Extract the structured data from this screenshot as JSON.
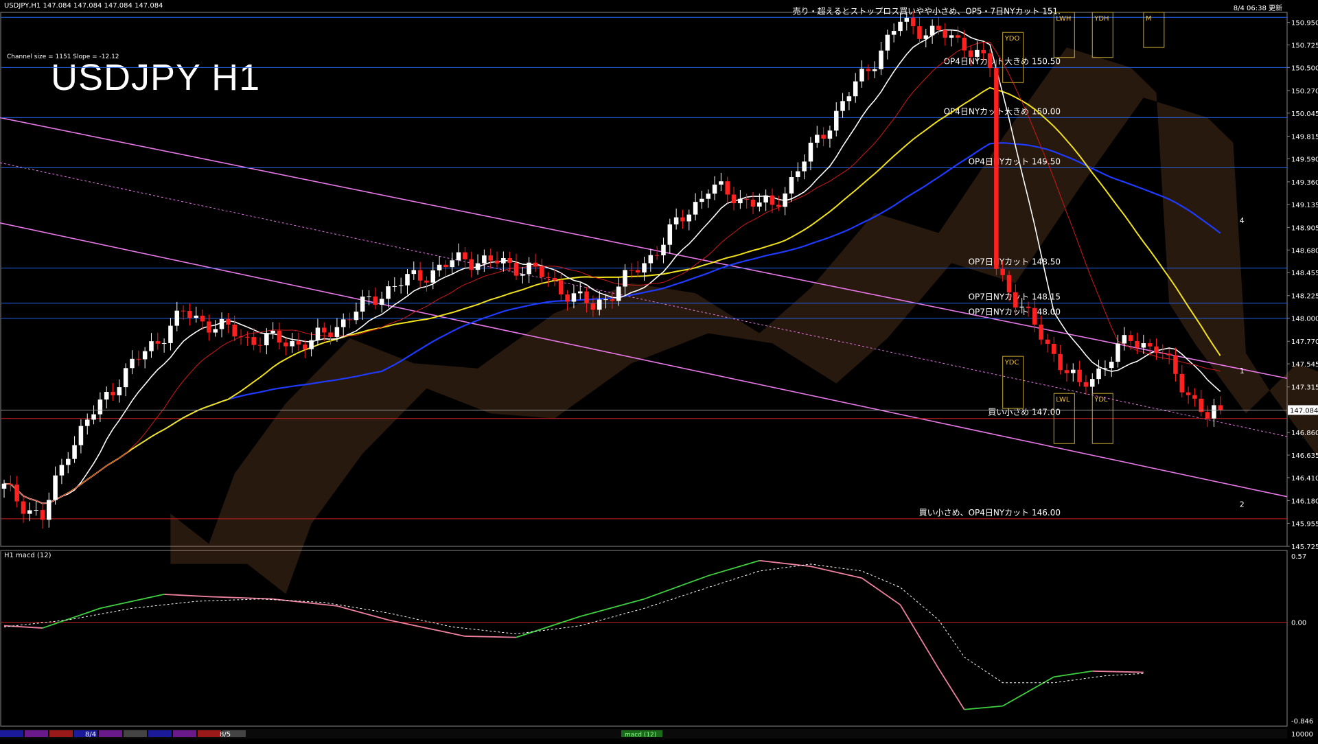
{
  "header": {
    "symbol_line": "USDJPY,H1  147.084 147.084 147.084 147.084",
    "timestamp": "8/4 06:38 更新",
    "channel_info": "Channel size = 1151 Slope = -12.12",
    "chart_title": "USDJPY H1"
  },
  "chart_data": [
    {
      "type": "candlestick",
      "title": "USDJPY H1",
      "y_ticks": [
        "150.950",
        "150.725",
        "150.500",
        "150.270",
        "150.045",
        "149.815",
        "149.590",
        "149.360",
        "149.135",
        "148.905",
        "148.680",
        "148.455",
        "148.225",
        "148.000",
        "147.770",
        "147.545",
        "147.315",
        "147.084",
        "146.860",
        "146.635",
        "146.410",
        "146.180",
        "145.955",
        "145.725"
      ],
      "ylim": [
        145.725,
        151.05
      ],
      "current_price": "147.084",
      "bar_count": 200,
      "close_path": [
        [
          0,
          146.3
        ],
        [
          6,
          146.0
        ],
        [
          10,
          146.7
        ],
        [
          18,
          147.4
        ],
        [
          28,
          148.05
        ],
        [
          38,
          147.8
        ],
        [
          48,
          147.75
        ],
        [
          60,
          148.3
        ],
        [
          72,
          148.6
        ],
        [
          82,
          148.5
        ],
        [
          92,
          148.1
        ],
        [
          100,
          148.55
        ],
        [
          110,
          149.3
        ],
        [
          120,
          149.1
        ],
        [
          130,
          150.05
        ],
        [
          140,
          150.95
        ],
        [
          150,
          150.75
        ],
        [
          154,
          150.5
        ],
        [
          155,
          148.5
        ],
        [
          160,
          148.0
        ],
        [
          168,
          147.3
        ],
        [
          176,
          147.8
        ],
        [
          180,
          147.7
        ],
        [
          188,
          147.0
        ],
        [
          190,
          147.084
        ]
      ],
      "levels": [
        {
          "price": 151.0,
          "label": "売り・超えるとストップロス買いやや小さめ、OP5・7日NYカット 151.",
          "color": "#2266ee"
        },
        {
          "price": 150.5,
          "label": "OP4日NYカット大きめ 150.50",
          "color": "#2266ee"
        },
        {
          "price": 150.0,
          "label": "OP4日NYカット大きめ 150.00",
          "color": "#2266ee"
        },
        {
          "price": 149.5,
          "label": "OP4日NYカット 149.50",
          "color": "#2266ee"
        },
        {
          "price": 148.5,
          "label": "OP7日NYカット 148.50",
          "color": "#2266ee"
        },
        {
          "price": 148.15,
          "label": "OP7日NYカット 148.15",
          "color": "#2266ee"
        },
        {
          "price": 148.0,
          "label": "OP7日NYカット 148.00",
          "color": "#2266ee"
        },
        {
          "price": 147.0,
          "label": "買い小さめ 147.00",
          "color": "#cc2222"
        },
        {
          "price": 146.0,
          "label": "買い小さめ、OP4日NYカット 146.00",
          "color": "#cc2222"
        }
      ],
      "box_labels": [
        "LWH",
        "YDH",
        "M",
        "YDO",
        "YDC",
        "LWL",
        "YDL"
      ],
      "wave_labels": [
        "4",
        "1",
        "2"
      ]
    },
    {
      "type": "line",
      "title": "H1 macd (12)",
      "y_ticks": [
        "0.57",
        "0.00",
        "-0.846"
      ],
      "ylim": [
        -0.846,
        0.57
      ],
      "macd_path": [
        [
          0,
          -0.03
        ],
        [
          6,
          -0.05
        ],
        [
          15,
          0.12
        ],
        [
          25,
          0.24
        ],
        [
          32,
          0.22
        ],
        [
          42,
          0.2
        ],
        [
          52,
          0.14
        ],
        [
          60,
          0.02
        ],
        [
          72,
          -0.12
        ],
        [
          80,
          -0.13
        ],
        [
          90,
          0.05
        ],
        [
          100,
          0.2
        ],
        [
          110,
          0.4
        ],
        [
          118,
          0.53
        ],
        [
          126,
          0.48
        ],
        [
          134,
          0.38
        ],
        [
          140,
          0.15
        ],
        [
          146,
          -0.4
        ],
        [
          150,
          -0.75
        ],
        [
          156,
          -0.72
        ],
        [
          164,
          -0.47
        ],
        [
          170,
          -0.42
        ],
        [
          178,
          -0.43
        ]
      ],
      "signal_path": [
        [
          0,
          -0.04
        ],
        [
          10,
          0.02
        ],
        [
          20,
          0.12
        ],
        [
          30,
          0.18
        ],
        [
          40,
          0.2
        ],
        [
          50,
          0.17
        ],
        [
          60,
          0.08
        ],
        [
          70,
          -0.04
        ],
        [
          80,
          -0.1
        ],
        [
          90,
          -0.03
        ],
        [
          100,
          0.12
        ],
        [
          110,
          0.3
        ],
        [
          118,
          0.44
        ],
        [
          126,
          0.5
        ],
        [
          134,
          0.44
        ],
        [
          140,
          0.3
        ],
        [
          146,
          0.02
        ],
        [
          150,
          -0.3
        ],
        [
          156,
          -0.52
        ],
        [
          164,
          -0.52
        ],
        [
          172,
          -0.46
        ],
        [
          178,
          -0.44
        ]
      ]
    }
  ],
  "bottom_bar": {
    "dates": [
      "8/4",
      "8/5"
    ],
    "indicator": "macd (12)",
    "value_right": "10000"
  }
}
